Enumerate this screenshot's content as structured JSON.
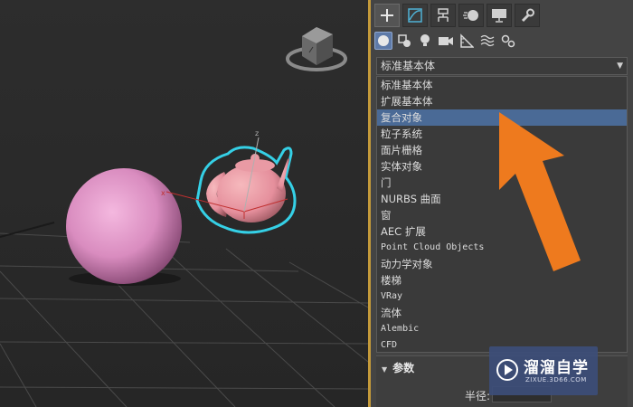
{
  "command_panel": {
    "tabs": [
      {
        "icon": "plus-icon",
        "active": true
      },
      {
        "icon": "modify-curve-icon",
        "active": false
      },
      {
        "icon": "hierarchy-icon",
        "active": false
      },
      {
        "icon": "motion-icon",
        "active": false
      },
      {
        "icon": "display-monitor-icon",
        "active": false
      },
      {
        "icon": "wrench-icon",
        "active": false
      }
    ],
    "sub_tabs": [
      {
        "icon": "geometry-sphere-icon",
        "active": true
      },
      {
        "icon": "shapes-icon",
        "active": false
      },
      {
        "icon": "lights-bulb-icon",
        "active": false
      },
      {
        "icon": "camera-icon",
        "active": false
      },
      {
        "icon": "helpers-ruler-icon",
        "active": false
      },
      {
        "icon": "space-warps-icon",
        "active": false
      },
      {
        "icon": "systems-gears-icon",
        "active": false
      }
    ],
    "category_dropdown": {
      "selected": "标准基本体"
    },
    "category_list": {
      "selected_index": 2,
      "items": [
        "标准基本体",
        "扩展基本体",
        "复合对象",
        "粒子系统",
        "面片栅格",
        "实体对象",
        "门",
        "NURBS 曲面",
        "窗",
        "AEC 扩展",
        "Point Cloud Objects",
        "动力学对象",
        "楼梯",
        "VRay",
        "流体",
        "Alembic",
        "CFD"
      ]
    },
    "parameters_rollout": {
      "title": "参数",
      "radius_label": "半径:"
    }
  },
  "viewport": {
    "objects": [
      "sphere",
      "teapot"
    ],
    "sphere_color": "#d98cbf",
    "teapot_color": "#e58f9c",
    "selection_outline_color": "#35d0e6"
  },
  "watermark": {
    "brand": "溜溜自学",
    "url": "ZIXUE.3D66.COM"
  },
  "colors": {
    "accent_selection": "#4a6a96",
    "panel_bg": "#444444",
    "annotation_arrow": "#ee7a1e"
  }
}
